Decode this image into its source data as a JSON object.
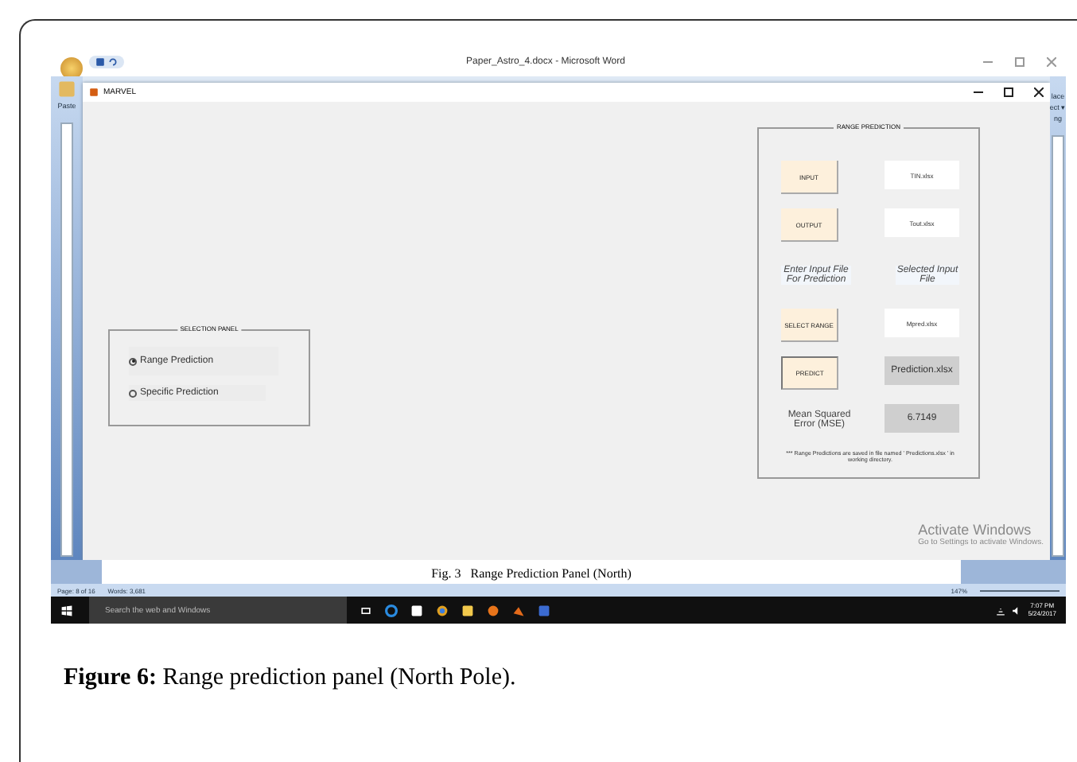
{
  "word": {
    "title": "Paper_Astro_4.docx - Microsoft Word",
    "ribbon_left": "Paste",
    "ribbon_right": [
      "lace",
      "ect ▾",
      "ng"
    ],
    "doc_caption": "Fig. 3   Range Prediction Panel (North)",
    "status": [
      "Page: 8 of 16",
      "Words: 3,681"
    ],
    "zoom": "147%"
  },
  "marvel": {
    "title": "MARVEL",
    "selection_panel": {
      "title": "SELECTION PANEL",
      "options": [
        {
          "label": "Range Prediction",
          "selected": true
        },
        {
          "label": "Specific Prediction",
          "selected": false
        }
      ]
    },
    "range_panel": {
      "title": "RANGE PREDICTION",
      "rows": [
        {
          "kind": "action",
          "button": "INPUT",
          "focused": false,
          "field": "TIN.xlsx",
          "readonly": false
        },
        {
          "kind": "action",
          "button": "OUTPUT",
          "focused": false,
          "field": "Tout.xlsx",
          "readonly": false
        },
        {
          "kind": "labels",
          "left": "Enter Input File For Prediction",
          "right": "Selected Input File"
        },
        {
          "kind": "action",
          "button": "SELECT RANGE",
          "focused": false,
          "field": "Mpred.xlsx",
          "readonly": false
        },
        {
          "kind": "action",
          "button": "PREDICT",
          "focused": true,
          "field": "Prediction.xlsx",
          "readonly": true
        },
        {
          "kind": "result",
          "label": "Mean Squared Error (MSE)",
          "value": "6.7149"
        }
      ],
      "note": "*** Range Predictions are saved in file named ' Predictions.xlsx ' in working directory."
    }
  },
  "activation": {
    "title": "Activate Windows",
    "hint": "Go to Settings to activate Windows."
  },
  "taskbar": {
    "search": {
      "placeholder": "Search the web and Windows"
    },
    "time": "7:07 PM",
    "date": "5/24/2017"
  },
  "caption": "**Figure 6:** Range prediction panel (North Pole)."
}
